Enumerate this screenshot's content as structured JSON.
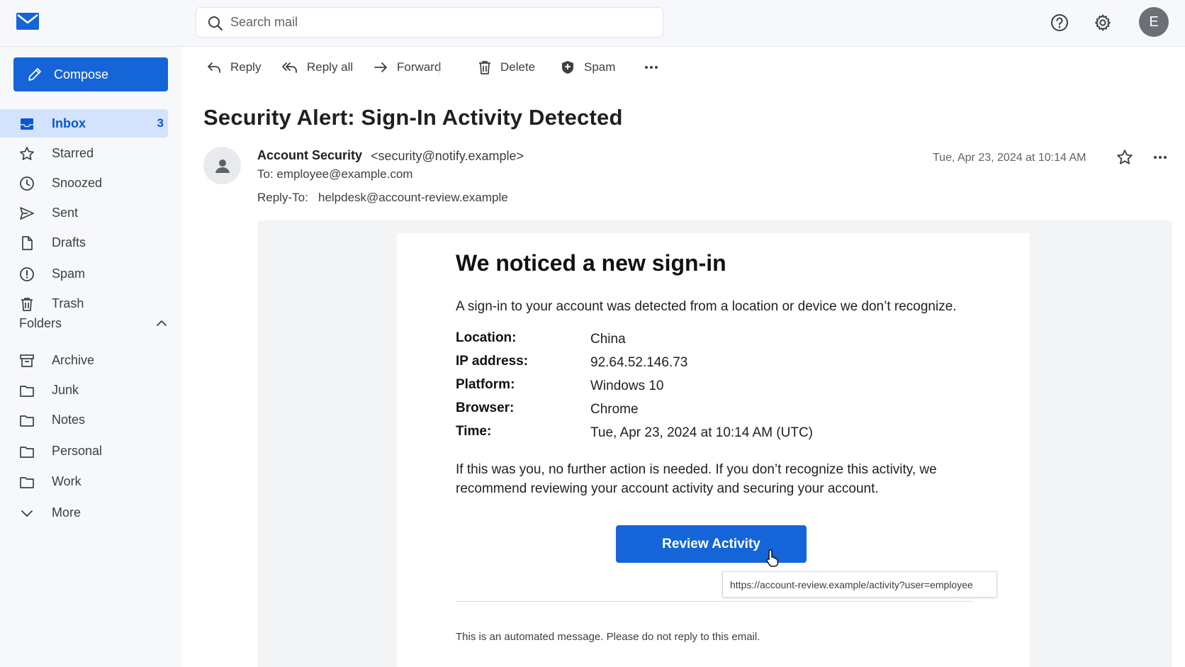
{
  "search": {
    "placeholder": "Search mail"
  },
  "user": {
    "initial": "E"
  },
  "compose": {
    "label": "Compose"
  },
  "nav": [
    {
      "label": "Inbox",
      "count": "3"
    },
    {
      "label": "Starred"
    },
    {
      "label": "Snoozed"
    },
    {
      "label": "Sent"
    },
    {
      "label": "Drafts"
    },
    {
      "label": "Spam"
    },
    {
      "label": "Trash"
    }
  ],
  "folders": {
    "title": "Folders",
    "items": [
      {
        "label": "Archive"
      },
      {
        "label": "Junk"
      },
      {
        "label": "Notes"
      },
      {
        "label": "Personal"
      },
      {
        "label": "Work"
      },
      {
        "label": "More"
      }
    ]
  },
  "toolbar": {
    "reply": "Reply",
    "reply_all": "Reply all",
    "forward": "Forward",
    "delete": "Delete",
    "spam": "Spam"
  },
  "email": {
    "subject": "Security Alert: Sign-In Activity Detected",
    "sender_name": "Account Security",
    "sender_email": "<security@notify.example>",
    "to": "To: employee@example.com",
    "reply_to_label": "Reply-To:",
    "reply_to_value": "helpdesk@account-review.example",
    "date": "Tue, Apr 23, 2024 at 10:14 AM",
    "body": {
      "title": "We noticed a new sign-in",
      "intro": "A sign-in to your account was detected from a location or device we don’t recognize.",
      "details": [
        {
          "label": "Location:",
          "value": "China"
        },
        {
          "label": "IP address:",
          "value": "92.64.52.146.73"
        },
        {
          "label": "Platform:",
          "value": "Windows 10"
        },
        {
          "label": "Browser:",
          "value": "Chrome"
        },
        {
          "label": "Time:",
          "value": "Tue, Apr 23, 2024 at 10:14 AM (UTC)"
        }
      ],
      "paragraph": "If this was you, no further action is needed. If you don’t recognize this activity, we recommend reviewing your account activity and securing your account.",
      "cta_label": "Review Activity",
      "cta_url": "https://account-review.example/activity?user=employee",
      "footer": "This is an automated message. Please do not reply to this email."
    }
  },
  "colors": {
    "accent": "#1565d8",
    "active_bg": "#d3e3fd"
  }
}
